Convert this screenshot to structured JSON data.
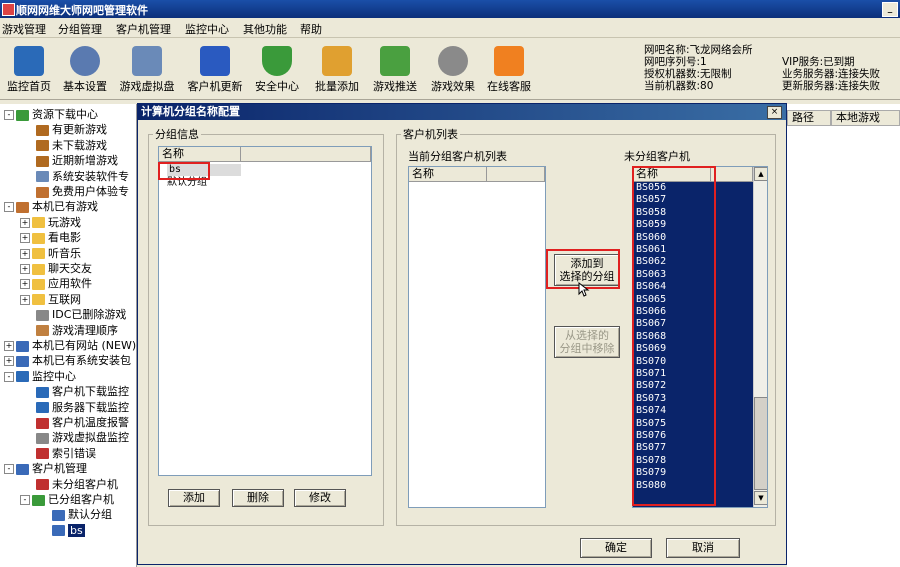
{
  "app": {
    "title": "顺网网维大师网吧管理软件"
  },
  "menu": [
    "游戏管理",
    "分组管理",
    "客户机管理",
    "监控中心",
    "其他功能",
    "帮助"
  ],
  "toolbar": [
    {
      "label": "监控首页",
      "icon": "monitor-icon",
      "color": "#2a6ab8"
    },
    {
      "label": "基本设置",
      "icon": "gear-icon",
      "color": "#5a7ab0"
    },
    {
      "label": "游戏虚拟盘",
      "icon": "disk-icon",
      "color": "#6a8ab8"
    },
    {
      "label": "客户机更新",
      "icon": "update-icon",
      "color": "#2a5ac0"
    },
    {
      "label": "安全中心",
      "icon": "shield-icon",
      "color": "#3a9a3a"
    },
    {
      "label": "批量添加",
      "icon": "folder-add-icon",
      "color": "#e0a030"
    },
    {
      "label": "游戏推送",
      "icon": "push-icon",
      "color": "#4aa040"
    },
    {
      "label": "游戏效果",
      "icon": "gamepad-icon",
      "color": "#8a8a8a"
    },
    {
      "label": "在线客服",
      "icon": "chat-icon",
      "color": "#f08020"
    }
  ],
  "info": {
    "netbar_name": "网吧名称:飞龙网络会所",
    "netbar_serial": "网吧序列号:1",
    "licensed_machines": "授权机器数:无限制",
    "current_machines": "当前机器数:80",
    "vip": "VIP服务:已到期",
    "business_server": "业务服务器:连接失败",
    "update_server": "更新服务器:连接失败"
  },
  "tree": [
    {
      "label": "资源下载中心",
      "exp": "-",
      "depth": 0,
      "color": "#3a9a3a"
    },
    {
      "label": "有更新游戏",
      "depth": 2,
      "color": "#b06a20"
    },
    {
      "label": "未下载游戏",
      "depth": 2,
      "color": "#b06a20"
    },
    {
      "label": "近期新增游戏",
      "depth": 2,
      "color": "#b06a20"
    },
    {
      "label": "系统安装软件专",
      "depth": 2,
      "color": "#6a8ab8"
    },
    {
      "label": "免费用户体验专",
      "depth": 2,
      "color": "#c07030"
    },
    {
      "label": "本机已有游戏",
      "exp": "-",
      "depth": 0,
      "color": "#c07030"
    },
    {
      "label": "玩游戏",
      "exp": "+",
      "depth": 1,
      "color": "#f0c040"
    },
    {
      "label": "看电影",
      "exp": "+",
      "depth": 1,
      "color": "#f0c040"
    },
    {
      "label": "听音乐",
      "exp": "+",
      "depth": 1,
      "color": "#f0c040"
    },
    {
      "label": "聊天交友",
      "exp": "+",
      "depth": 1,
      "color": "#f0c040"
    },
    {
      "label": "应用软件",
      "exp": "+",
      "depth": 1,
      "color": "#f0c040"
    },
    {
      "label": "互联网",
      "exp": "+",
      "depth": 1,
      "color": "#f0c040"
    },
    {
      "label": "IDC已删除游戏",
      "depth": 2,
      "color": "#888888"
    },
    {
      "label": "游戏清理顺序",
      "depth": 2,
      "color": "#c08040"
    },
    {
      "label": "本机已有网站 (NEW)",
      "exp": "+",
      "depth": 0,
      "color": "#3a6ab8"
    },
    {
      "label": "本机已有系统安装包",
      "exp": "+",
      "depth": 0,
      "color": "#3a6ab8"
    },
    {
      "label": "监控中心",
      "exp": "-",
      "depth": 0,
      "color": "#2a6ab8"
    },
    {
      "label": "客户机下载监控",
      "depth": 2,
      "color": "#2a6ab8"
    },
    {
      "label": "服务器下载监控",
      "depth": 2,
      "color": "#2a6ab8"
    },
    {
      "label": "客户机温度报警",
      "depth": 2,
      "color": "#c03030"
    },
    {
      "label": "游戏虚拟盘监控",
      "depth": 2,
      "color": "#888888"
    },
    {
      "label": "索引错误",
      "depth": 2,
      "color": "#c03030"
    },
    {
      "label": "客户机管理",
      "exp": "-",
      "depth": 0,
      "color": "#3a6ab8"
    },
    {
      "label": "未分组客户机",
      "depth": 2,
      "color": "#c03030"
    },
    {
      "label": "已分组客户机",
      "exp": "-",
      "depth": 1,
      "color": "#3a9a3a"
    },
    {
      "label": "默认分组",
      "depth": 3,
      "color": "#3a6ab8"
    },
    {
      "label": "bs",
      "depth": 3,
      "color": "#3a6ab8",
      "selected": true
    }
  ],
  "right_grid": {
    "col1": "路径",
    "col2": "本地游戏"
  },
  "dialog": {
    "title": "计算机分组名称配置",
    "close": "×",
    "group_info_legend": "分组信息",
    "group_col": "名称",
    "groups": [
      "bs",
      "默认分组"
    ],
    "add_btn": "添加",
    "delete_btn": "删除",
    "modify_btn": "修改",
    "client_legend": "客户机列表",
    "current_label": "当前分组客户机列表",
    "current_col": "名称",
    "ungrouped_label": "未分组客户机",
    "ungrouped_col": "名称",
    "ungrouped": [
      "BS056",
      "BS057",
      "BS058",
      "BS059",
      "BS060",
      "BS061",
      "BS062",
      "BS063",
      "BS064",
      "BS065",
      "BS066",
      "BS067",
      "BS068",
      "BS069",
      "BS070",
      "BS071",
      "BS072",
      "BS073",
      "BS074",
      "BS075",
      "BS076",
      "BS077",
      "BS078",
      "BS079",
      "BS080"
    ],
    "add_to_group_line1": "添加到",
    "add_to_group_line2": "选择的分组",
    "remove_line1": "从选择的",
    "remove_line2": "分组中移除",
    "ok": "确定",
    "cancel": "取消"
  },
  "colors": {
    "titlebar": "#0a246a",
    "selection": "#0a246a",
    "highlight_box": "#e02020",
    "window_bg": "#ece9d8"
  }
}
